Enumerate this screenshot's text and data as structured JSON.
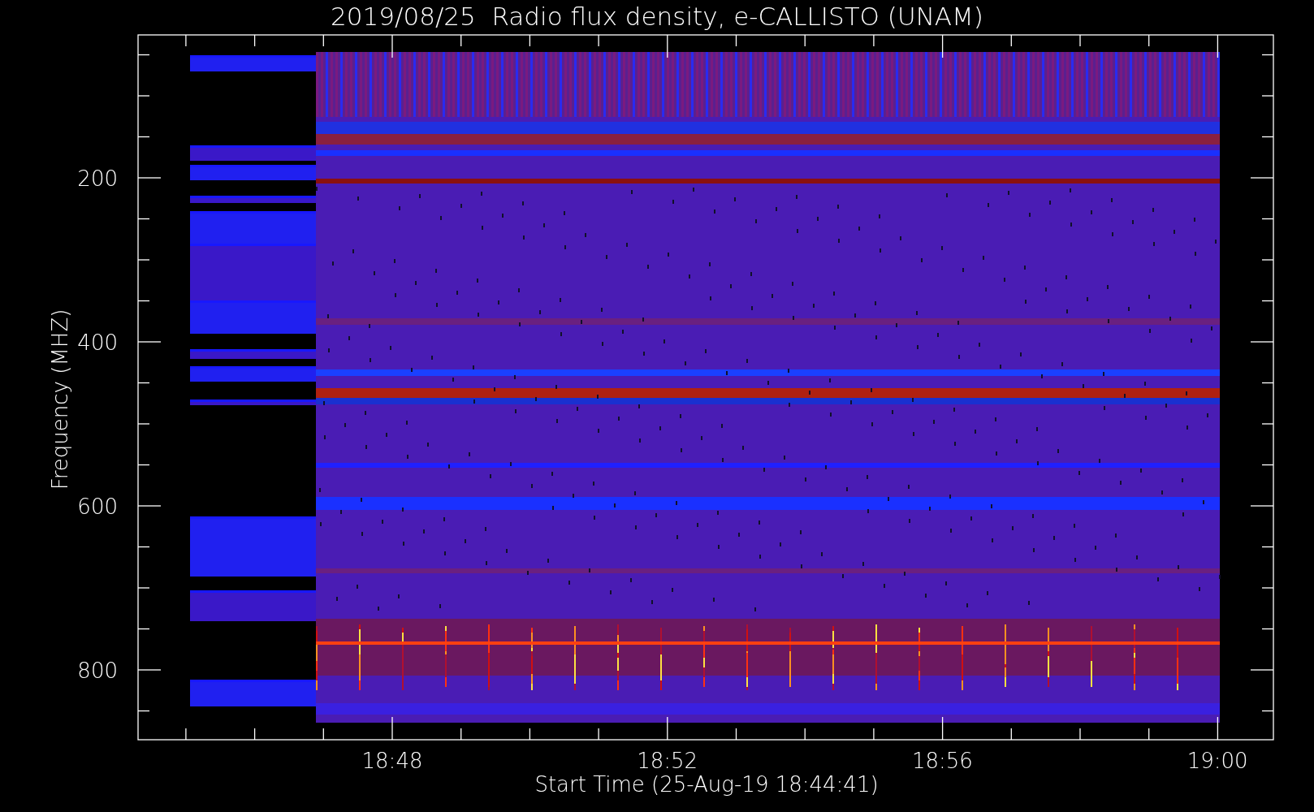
{
  "title": "2019/08/25  Radio flux density, e-CALLISTO (UNAM)",
  "x_axis": {
    "label": "Start Time (25-Aug-19 18:44:41)",
    "tick_labels": [
      "18:48",
      "18:52",
      "18:56",
      "19:00"
    ]
  },
  "y_axis": {
    "label": "Frequency (MHZ)",
    "tick_labels": [
      "200",
      "400",
      "600",
      "800"
    ]
  }
}
